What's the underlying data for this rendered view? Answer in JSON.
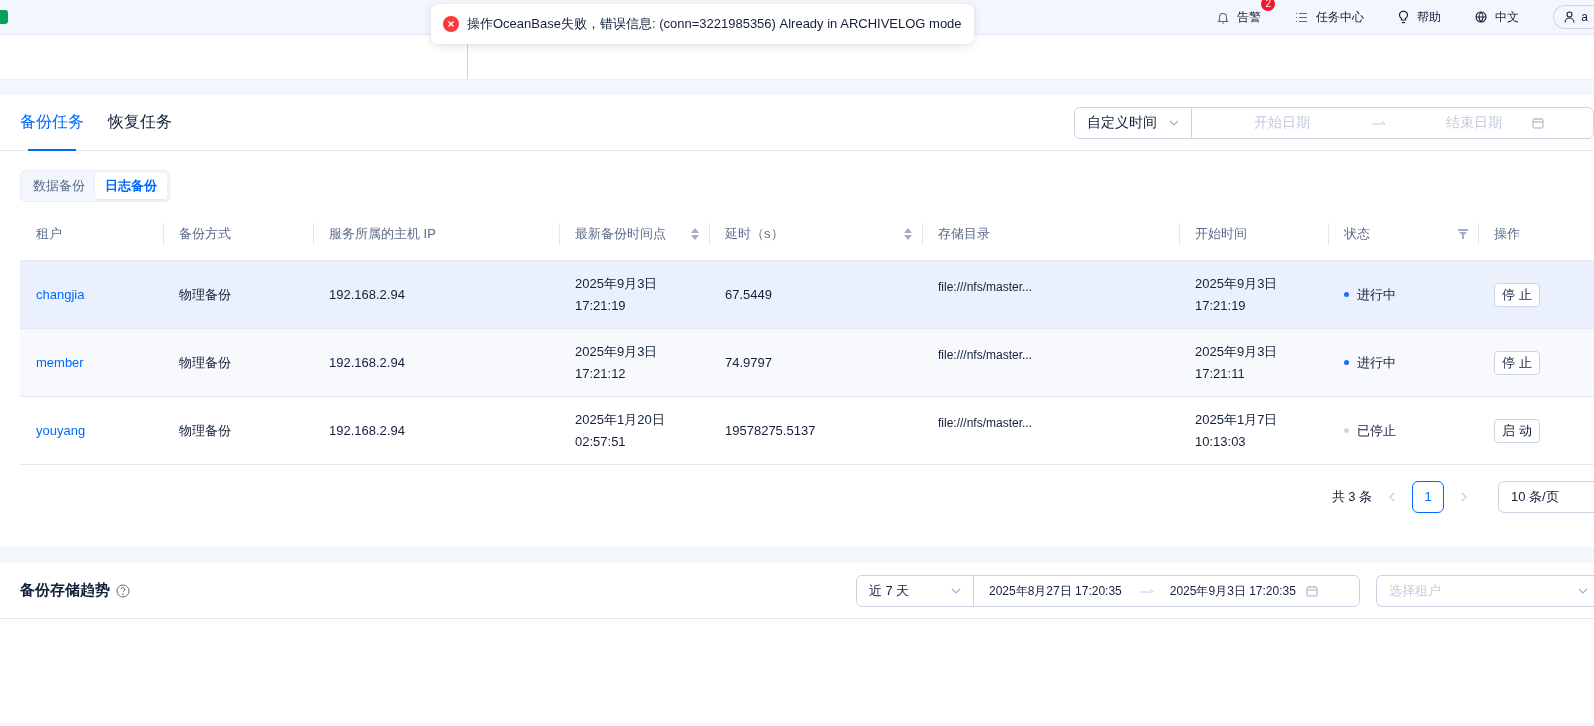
{
  "toast": {
    "kind": "error",
    "message": "操作OceanBase失败，错误信息: (conn=3221985356) Already in ARCHIVELOG mode"
  },
  "header": {
    "nav": [
      {
        "kind": "alert",
        "label": "告警",
        "badge": "2"
      },
      {
        "kind": "tasks",
        "label": "任务中心"
      },
      {
        "kind": "help",
        "label": "帮助"
      },
      {
        "kind": "language",
        "label": "中文"
      }
    ],
    "user": "a"
  },
  "tabs": [
    {
      "label": "备份任务",
      "selected": true
    },
    {
      "label": "恢复任务",
      "selected": false
    }
  ],
  "time_filter": {
    "mode": "自定义时间",
    "start_placeholder": "开始日期",
    "end_placeholder": "结束日期"
  },
  "segments": [
    {
      "label": "数据备份",
      "selected": false
    },
    {
      "label": "日志备份",
      "selected": true
    }
  ],
  "table": {
    "columns": [
      {
        "label": "租户"
      },
      {
        "label": "备份方式"
      },
      {
        "label": "服务所属的主机 IP"
      },
      {
        "label": "最新备份时间点",
        "sortable": true
      },
      {
        "label": "延时（s）",
        "sortable": true
      },
      {
        "label": "存储目录"
      },
      {
        "label": "开始时间"
      },
      {
        "label": "状态",
        "filterable": true
      },
      {
        "label": "操作"
      }
    ],
    "rows": [
      {
        "selected": true,
        "tenant": "changjia",
        "method": "物理备份",
        "ip": "192.168.2.94",
        "latest": [
          "2025年9月3日",
          "17:21:19"
        ],
        "delay": "67.5449",
        "dir": "file:///nfs/master...",
        "start": [
          "2025年9月3日",
          "17:21:19"
        ],
        "status": "进行中",
        "color": "#1a6cff",
        "action": "停 止"
      },
      {
        "selected": false,
        "tenant": "member",
        "method": "物理备份",
        "ip": "192.168.2.94",
        "latest": [
          "2025年9月3日",
          "17:21:12"
        ],
        "delay": "74.9797",
        "dir": "file:///nfs/master...",
        "start": [
          "2025年9月3日",
          "17:21:11"
        ],
        "status": "进行中",
        "color": "#1a6cff",
        "action": "停 止"
      },
      {
        "selected": false,
        "tenant": "youyang",
        "method": "物理备份",
        "ip": "192.168.2.94",
        "latest": [
          "2025年1月20日",
          "02:57:51"
        ],
        "delay": "19578275.5137",
        "dir": "file:///nfs/master...",
        "start": [
          "2025年1月7日",
          "10:13:03"
        ],
        "status": "已停止",
        "color": "#cdd5e4",
        "action": "启 动"
      }
    ]
  },
  "pagination": {
    "total": "共 3 条",
    "pages": [
      {
        "label": "1",
        "selected": true
      }
    ],
    "page_size": "10 条/页"
  },
  "trend": {
    "title": "备份存储趋势",
    "range": "近 7 天",
    "start": "2025年8月27日 17:20:35",
    "end": "2025年9月3日 17:20:35",
    "tenant_placeholder": "选择租户"
  }
}
